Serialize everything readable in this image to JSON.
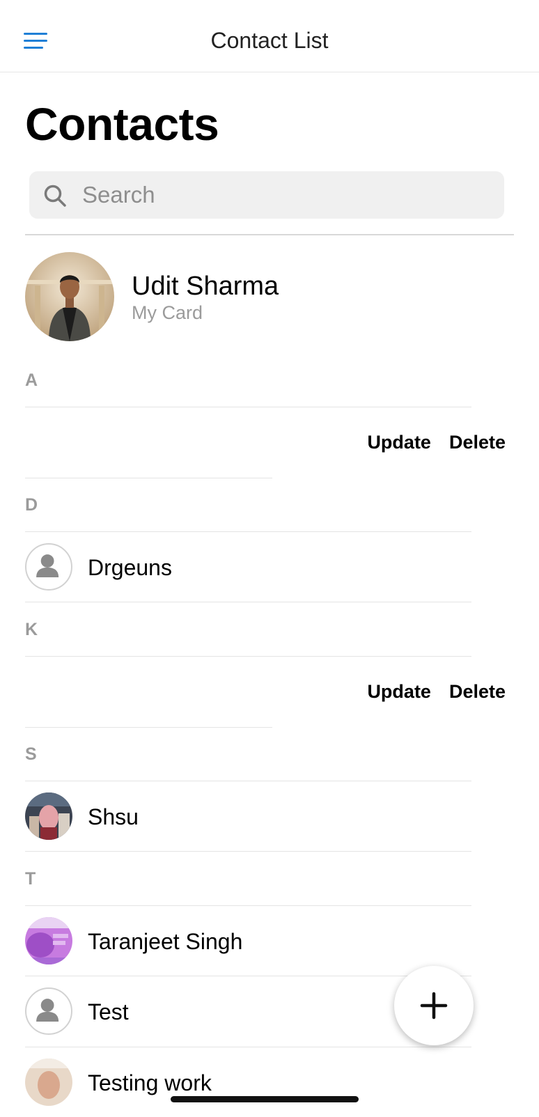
{
  "header": {
    "title": "Contact List",
    "menu_icon": "hamburger-menu-icon"
  },
  "page": {
    "large_title": "Contacts"
  },
  "search": {
    "placeholder": "Search",
    "icon": "search-icon"
  },
  "my_card": {
    "name": "Udit Sharma",
    "subtitle": "My Card"
  },
  "sections": [
    {
      "letter": "A"
    },
    {
      "letter": "D"
    },
    {
      "letter": "K"
    },
    {
      "letter": "S"
    },
    {
      "letter": "T"
    }
  ],
  "swipe_actions": {
    "update_label": "Update",
    "delete_label": "Delete"
  },
  "contacts": [
    {
      "name": "Drgeuns",
      "avatar": "person-placeholder-icon"
    },
    {
      "name": "Shsu",
      "avatar": "photo"
    },
    {
      "name": "Taranjeet Singh",
      "avatar": "photo"
    },
    {
      "name": "Test",
      "avatar": "person-placeholder-icon"
    },
    {
      "name": "Testing work",
      "avatar": "photo"
    }
  ],
  "fab": {
    "icon": "plus-icon"
  },
  "colors": {
    "accent": "#1f7fd6",
    "secondary_text": "#9b9b9b",
    "search_bg": "#f0f0f0"
  }
}
